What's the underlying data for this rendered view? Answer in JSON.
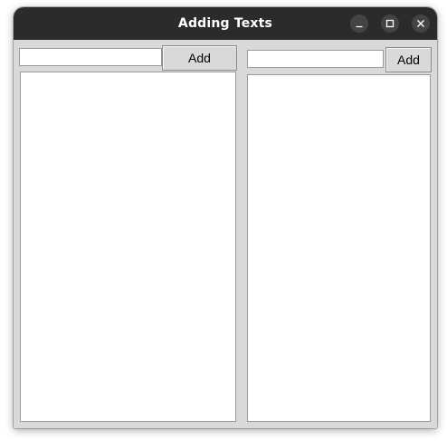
{
  "window": {
    "title": "Adding Texts"
  },
  "left_panel": {
    "input_value": "",
    "add_label": "Add"
  },
  "right_panel": {
    "input_value": "",
    "add_label": "Add"
  },
  "icons": {
    "minimize": "minimize-icon",
    "maximize": "maximize-icon",
    "close": "close-icon"
  },
  "colors": {
    "titlebar": "#2b2b2b",
    "window_bg": "#d9d9d9",
    "field_bg": "#ffffff"
  }
}
